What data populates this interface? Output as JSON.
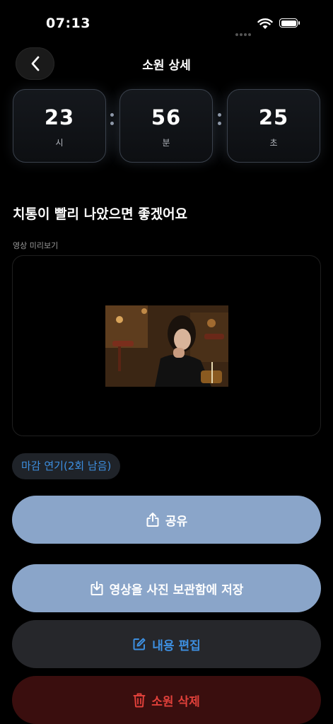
{
  "status_bar": {
    "time": "07:13"
  },
  "header": {
    "title": "소원 상세"
  },
  "timer": {
    "hours": "23",
    "hours_label": "시",
    "minutes": "56",
    "minutes_label": "분",
    "seconds": "25",
    "seconds_label": "초"
  },
  "wish": {
    "title": "치통이 빨리 나았으면 좋겠어요"
  },
  "preview": {
    "label": "영상 미리보기"
  },
  "extend": {
    "label": "마감 연기(2회 남음)"
  },
  "actions": {
    "share_label": "공유",
    "save_label": "영상을 사진 보관함에 저장",
    "edit_label": "내용 편집",
    "delete_label": "소원 삭제"
  },
  "colors": {
    "primary_button": "#8aa5c9",
    "accent_blue": "#3d8fe0",
    "delete_red": "#e0403a",
    "delete_bg": "#3a0e0e"
  },
  "icons": {
    "back": "chevron-left-icon",
    "share": "share-icon",
    "save": "download-icon",
    "edit": "edit-icon",
    "delete": "trash-icon"
  }
}
